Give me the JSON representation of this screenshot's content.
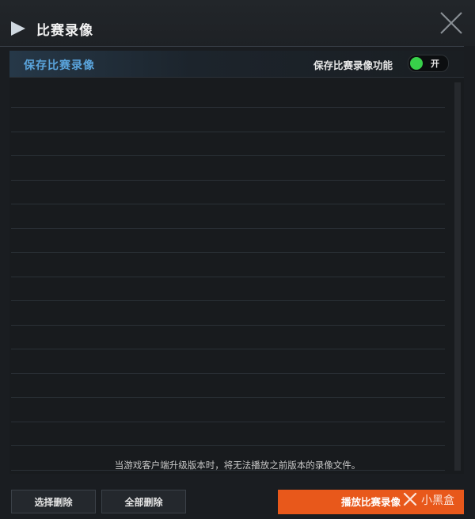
{
  "window": {
    "title": "比赛录像",
    "play_icon": "play-triangle-icon",
    "close_icon": "close-x-icon"
  },
  "panel": {
    "title": "保存比赛录像",
    "toggle_label": "保存比赛录像功能",
    "toggle_state": "开",
    "toggle_on": true,
    "toggle_color": "#38d04a",
    "header_accent": "#5aa4dc"
  },
  "list": {
    "rows": [
      "",
      "",
      "",
      "",
      "",
      "",
      "",
      "",
      "",
      "",
      "",
      "",
      "",
      "",
      "",
      ""
    ]
  },
  "notice": "当游戏客户端升级版本时，将无法播放之前版本的录像文件。",
  "buttons": {
    "select_delete": "选择删除",
    "delete_all": "全部删除",
    "play": "播放比赛录像",
    "play_color": "#e8581b"
  },
  "watermark": {
    "text": "小黑盒",
    "icon": "xiaoheihe-logo-icon"
  }
}
